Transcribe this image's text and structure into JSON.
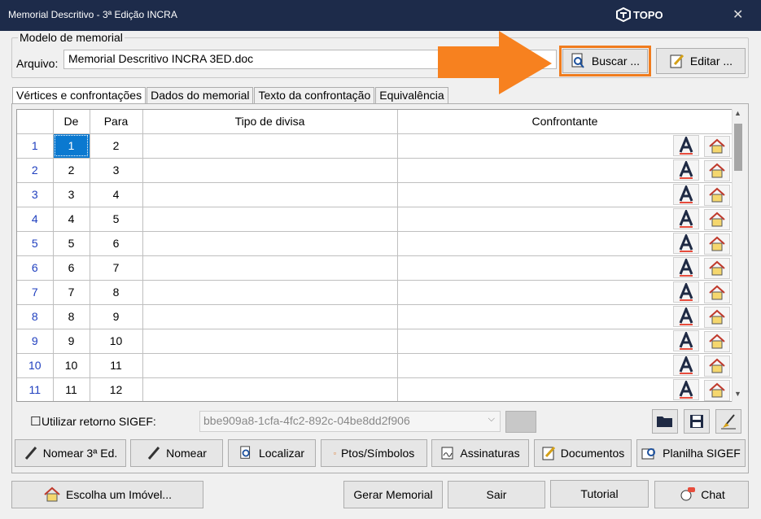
{
  "window": {
    "title": "Memorial Descritivo - 3ª Edição INCRA",
    "brand": "TOPO",
    "close": "✕"
  },
  "modelo": {
    "legend": "Modelo de memorial",
    "arquivo_label": "Arquivo:",
    "arquivo_value": "Memorial Descritivo INCRA 3ED.doc",
    "buscar": "Buscar ...",
    "editar": "Editar ..."
  },
  "tabs": [
    "Vértices e confrontações",
    "Dados do memorial",
    "Texto da confrontação",
    "Equivalência"
  ],
  "grid": {
    "headers": {
      "de": "De",
      "para": "Para",
      "tipo": "Tipo de divisa",
      "confrontante": "Confrontante"
    },
    "rows": [
      {
        "n": "1",
        "de": "1",
        "para": "2"
      },
      {
        "n": "2",
        "de": "2",
        "para": "3"
      },
      {
        "n": "3",
        "de": "3",
        "para": "4"
      },
      {
        "n": "4",
        "de": "4",
        "para": "5"
      },
      {
        "n": "5",
        "de": "5",
        "para": "6"
      },
      {
        "n": "6",
        "de": "6",
        "para": "7"
      },
      {
        "n": "7",
        "de": "7",
        "para": "8"
      },
      {
        "n": "8",
        "de": "8",
        "para": "9"
      },
      {
        "n": "9",
        "de": "9",
        "para": "10"
      },
      {
        "n": "10",
        "de": "10",
        "para": "11"
      },
      {
        "n": "11",
        "de": "11",
        "para": "12"
      }
    ]
  },
  "sigef": {
    "checkbox_label": "Utilizar retorno SIGEF:",
    "checked": false,
    "value": "bbe909a8-1cfa-4fc2-892c-04be8dd2f906"
  },
  "actions": {
    "nomear3": "Nomear 3ª Ed.",
    "nomear": "Nomear",
    "localizar": "Localizar",
    "ptos": "Ptos/Símbolos",
    "assinaturas": "Assinaturas",
    "documentos": "Documentos",
    "planilha": "Planilha SIGEF"
  },
  "footer": {
    "imovel": "Escolha um Imóvel...",
    "gerar": "Gerar Memorial",
    "sair": "Sair",
    "tutorial": "Tutorial",
    "chat": "Chat"
  },
  "colors": {
    "titlebar": "#1d2b4a",
    "highlight": "#f07c1e",
    "selection": "#0b79d0",
    "rownum": "#1f3fbf"
  }
}
